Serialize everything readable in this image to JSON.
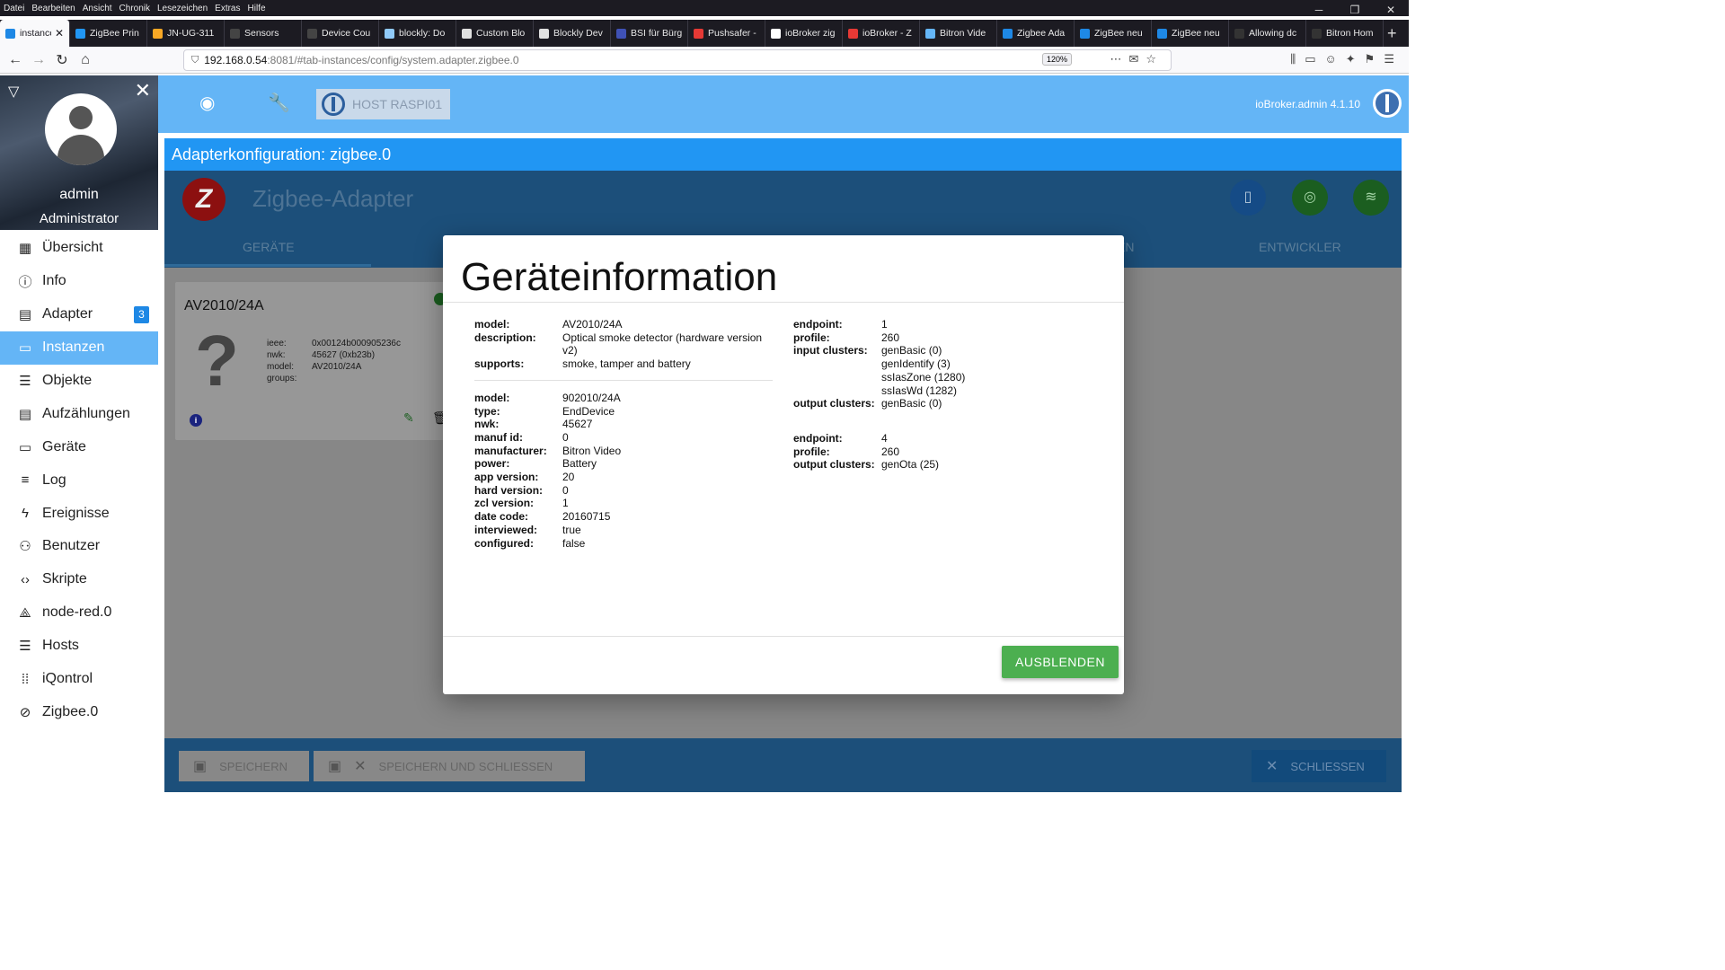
{
  "browser": {
    "menu": [
      "Datei",
      "Bearbeiten",
      "Ansicht",
      "Chronik",
      "Lesezeichen",
      "Extras",
      "Hilfe"
    ],
    "tabs": [
      {
        "label": "instance",
        "color": "#1e88e5"
      },
      {
        "label": "ZigBee Prin",
        "color": "#2196f3"
      },
      {
        "label": "JN-UG-311",
        "color": "#f9a825"
      },
      {
        "label": "Sensors",
        "color": "#444444"
      },
      {
        "label": "Device Cou",
        "color": "#444444"
      },
      {
        "label": "blockly: Do",
        "color": "#90caf9"
      },
      {
        "label": "Custom Blo",
        "color": "#e0e0e0"
      },
      {
        "label": "Blockly Dev",
        "color": "#e0e0e0"
      },
      {
        "label": "BSI für Bürg",
        "color": "#3f51b5"
      },
      {
        "label": "Pushsafer -",
        "color": "#e53935"
      },
      {
        "label": "ioBroker zig",
        "color": "#ffffff"
      },
      {
        "label": "ioBroker - Z",
        "color": "#e53935"
      },
      {
        "label": "Bitron Vide",
        "color": "#64b5f6"
      },
      {
        "label": "Zigbee Ada",
        "color": "#1e88e5"
      },
      {
        "label": "ZigBee neu",
        "color": "#1e88e5"
      },
      {
        "label": "ZigBee neu",
        "color": "#1e88e5"
      },
      {
        "label": "Allowing dc",
        "color": "#333333"
      },
      {
        "label": "Bitron Hom",
        "color": "#333333"
      }
    ],
    "url_host": "192.168.0.54",
    "url_path": ":8081/#tab-instances/config/system.adapter.zigbee.0",
    "zoom": "120%"
  },
  "sidebar": {
    "user_name": "admin",
    "user_role": "Administrator",
    "items": [
      {
        "label": "Übersicht",
        "icon": "grid-icon"
      },
      {
        "label": "Info",
        "icon": "info-icon"
      },
      {
        "label": "Adapter",
        "icon": "store-icon",
        "badge": "3"
      },
      {
        "label": "Instanzen",
        "icon": "instances-icon",
        "active": true
      },
      {
        "label": "Objekte",
        "icon": "list-icon"
      },
      {
        "label": "Aufzählungen",
        "icon": "enum-icon"
      },
      {
        "label": "Geräte",
        "icon": "devices-icon"
      },
      {
        "label": "Log",
        "icon": "log-icon"
      },
      {
        "label": "Ereignisse",
        "icon": "bolt-icon"
      },
      {
        "label": "Benutzer",
        "icon": "user-icon"
      },
      {
        "label": "Skripte",
        "icon": "code-icon"
      },
      {
        "label": "node-red.0",
        "icon": "nodered-icon"
      },
      {
        "label": "Hosts",
        "icon": "hosts-icon"
      },
      {
        "label": "iQontrol",
        "icon": "dots-icon"
      },
      {
        "label": "Zigbee.0",
        "icon": "zigbee-icon"
      }
    ]
  },
  "topbar": {
    "host_label": "HOST RASPI01",
    "version": "ioBroker.admin 4.1.10"
  },
  "config": {
    "title": "Adapterkonfiguration: zigbee.0",
    "adapter_title": "Zigbee-Adapter",
    "tabs": [
      "GERÄTE",
      "EN",
      "ENTWICKLER"
    ]
  },
  "device_card": {
    "title": "AV2010/24A",
    "fields": [
      {
        "k": "ieee:",
        "v": "0x00124b000905236c"
      },
      {
        "k": "nwk:",
        "v": "45627 (0xb23b)"
      },
      {
        "k": "model:",
        "v": "AV2010/24A"
      },
      {
        "k": "groups:",
        "v": ""
      }
    ]
  },
  "dialog": {
    "title": "Geräteinformation",
    "section1": [
      {
        "k": "model:",
        "v": "AV2010/24A"
      },
      {
        "k": "description:",
        "v": "Optical smoke detector (hardware version v2)"
      },
      {
        "k": "supports:",
        "v": "smoke, tamper and battery"
      }
    ],
    "section2": [
      {
        "k": "model:",
        "v": "902010/24A"
      },
      {
        "k": "type:",
        "v": "EndDevice"
      },
      {
        "k": "nwk:",
        "v": "45627"
      },
      {
        "k": "manuf id:",
        "v": "0"
      },
      {
        "k": "manufacturer:",
        "v": "Bitron Video"
      },
      {
        "k": "power:",
        "v": "Battery"
      },
      {
        "k": "app version:",
        "v": "20"
      },
      {
        "k": "hard version:",
        "v": "0"
      },
      {
        "k": "zcl version:",
        "v": "1"
      },
      {
        "k": "date code:",
        "v": "20160715"
      },
      {
        "k": "interviewed:",
        "v": "true"
      },
      {
        "k": "configured:",
        "v": "false"
      }
    ],
    "endpoint1": {
      "endpoint": "1",
      "profile": "260",
      "input_clusters": [
        "genBasic (0)",
        "genIdentify (3)",
        "ssIasZone (1280)",
        "ssIasWd (1282)"
      ],
      "output_clusters": [
        "genBasic (0)"
      ]
    },
    "endpoint2": {
      "endpoint": "4",
      "profile": "260",
      "output_clusters": [
        "genOta (25)"
      ]
    },
    "labels": {
      "endpoint": "endpoint:",
      "profile": "profile:",
      "input_clusters": "input clusters:",
      "output_clusters": "output clusters:"
    },
    "hide_button": "AUSBLENDEN"
  },
  "bottom": {
    "save": "SPEICHERN",
    "save_close": "SPEICHERN UND SCHLIESSEN",
    "close": "SCHLIESSEN"
  }
}
